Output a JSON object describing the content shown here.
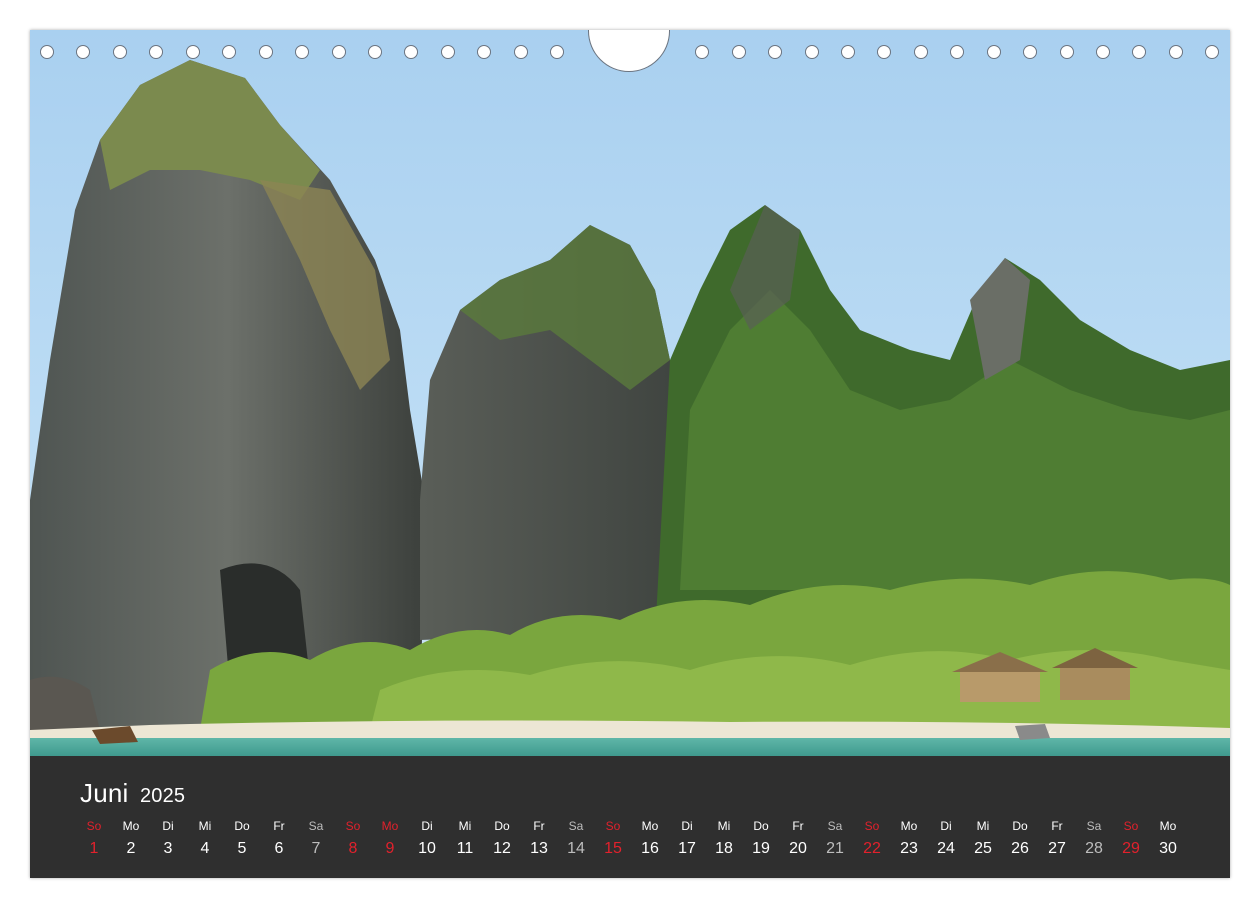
{
  "calendar": {
    "month": "Juni",
    "year": "2025",
    "days": [
      {
        "name": "So",
        "num": "1",
        "kind": "sun"
      },
      {
        "name": "Mo",
        "num": "2",
        "kind": ""
      },
      {
        "name": "Di",
        "num": "3",
        "kind": ""
      },
      {
        "name": "Mi",
        "num": "4",
        "kind": ""
      },
      {
        "name": "Do",
        "num": "5",
        "kind": ""
      },
      {
        "name": "Fr",
        "num": "6",
        "kind": ""
      },
      {
        "name": "Sa",
        "num": "7",
        "kind": "sat"
      },
      {
        "name": "So",
        "num": "8",
        "kind": "sun"
      },
      {
        "name": "Mo",
        "num": "9",
        "kind": "hol"
      },
      {
        "name": "Di",
        "num": "10",
        "kind": ""
      },
      {
        "name": "Mi",
        "num": "11",
        "kind": ""
      },
      {
        "name": "Do",
        "num": "12",
        "kind": ""
      },
      {
        "name": "Fr",
        "num": "13",
        "kind": ""
      },
      {
        "name": "Sa",
        "num": "14",
        "kind": "sat"
      },
      {
        "name": "So",
        "num": "15",
        "kind": "sun"
      },
      {
        "name": "Mo",
        "num": "16",
        "kind": ""
      },
      {
        "name": "Di",
        "num": "17",
        "kind": ""
      },
      {
        "name": "Mi",
        "num": "18",
        "kind": ""
      },
      {
        "name": "Do",
        "num": "19",
        "kind": ""
      },
      {
        "name": "Fr",
        "num": "20",
        "kind": ""
      },
      {
        "name": "Sa",
        "num": "21",
        "kind": "sat"
      },
      {
        "name": "So",
        "num": "22",
        "kind": "sun"
      },
      {
        "name": "Mo",
        "num": "23",
        "kind": ""
      },
      {
        "name": "Di",
        "num": "24",
        "kind": ""
      },
      {
        "name": "Mi",
        "num": "25",
        "kind": ""
      },
      {
        "name": "Do",
        "num": "26",
        "kind": ""
      },
      {
        "name": "Fr",
        "num": "27",
        "kind": ""
      },
      {
        "name": "Sa",
        "num": "28",
        "kind": "sat"
      },
      {
        "name": "So",
        "num": "29",
        "kind": "sun"
      },
      {
        "name": "Mo",
        "num": "30",
        "kind": ""
      }
    ]
  },
  "colors": {
    "calendar_bg": "#2f2f2f",
    "weekday_text": "#ffffff",
    "sunday_holiday_text": "#e2212c",
    "saturday_text": "#bdbdbd"
  }
}
